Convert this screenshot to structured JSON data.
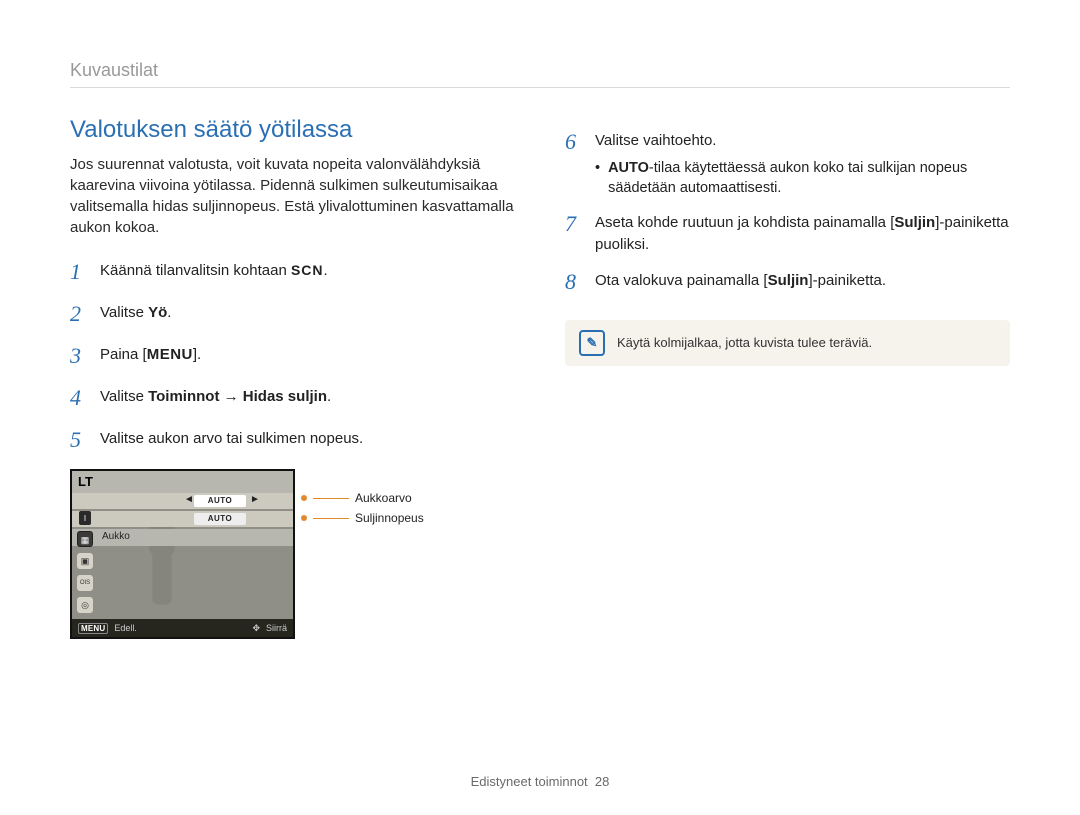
{
  "header": {
    "breadcrumb": "Kuvaustilat"
  },
  "title": "Valotuksen säätö yötilassa",
  "intro": "Jos suurennat valotusta, voit kuvata nopeita valonvälähdyksiä kaarevina viivoina yötilassa. Pidennä sulkimen sulkeutumisaikaa valitsemalla hidas suljinnopeus. Estä ylivalottuminen kasvattamalla aukon kokoa.",
  "steps_left": {
    "1": {
      "pre": "Käännä tilanvalitsin kohtaan ",
      "glyph": "SCN",
      "post": "."
    },
    "2": {
      "pre": "Valitse ",
      "bold": "Yö",
      "post": "."
    },
    "3": {
      "pre": "Paina [",
      "glyph": "MENU",
      "post": "]."
    },
    "4": {
      "pre": "Valitse ",
      "bold1": "Toiminnot",
      "arrow": " → ",
      "bold2": "Hidas suljin",
      "post": "."
    },
    "5": "Valitse aukon arvo tai sulkimen nopeus."
  },
  "steps_right": {
    "6": {
      "text": "Valitse vaihtoehto.",
      "bullet_bold": "AUTO",
      "bullet_rest": "-tilaa käytettäessä aukon koko tai sulkijan nopeus säädetään automaattisesti."
    },
    "7": {
      "pre": "Aseta kohde ruutuun ja kohdista painamalla [",
      "bold": "Suljin",
      "post": "]-painiketta puoliksi."
    },
    "8": {
      "pre": "Ota valokuva painamalla [",
      "bold": "Suljin",
      "post": "]-painiketta."
    }
  },
  "note": "Käytä kolmijalkaa, jotta kuvista tulee teräviä.",
  "diagram": {
    "lt": "LT",
    "auto1": "AUTO",
    "auto2": "AUTO",
    "aukko": "Aukko",
    "menu": "MENU",
    "edell": "Edell.",
    "siirra": "Siirrä",
    "callout1": "Aukkoarvo",
    "callout2": "Suljinnopeus",
    "side_i1": "I",
    "side_i4": "OIS"
  },
  "footer": {
    "text": "Edistyneet toiminnot",
    "page": "28"
  }
}
